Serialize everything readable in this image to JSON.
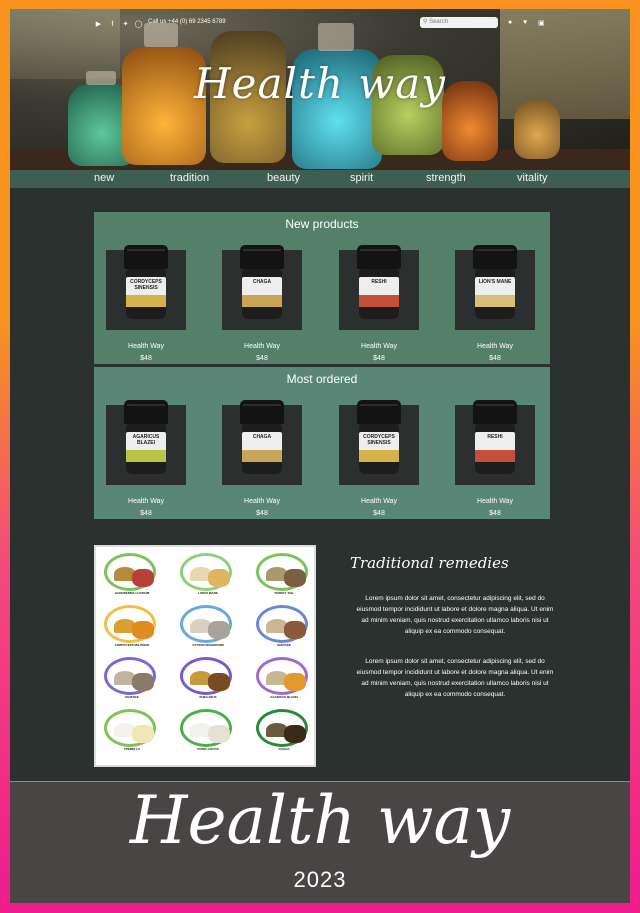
{
  "header": {
    "phone": "Call us +44 (0) 69 2345 6789",
    "search_placeholder": "Search",
    "logo_text": "Health way",
    "social_icons": [
      "youtube-icon",
      "facebook-icon",
      "twitter-icon",
      "instagram-icon"
    ],
    "user_icons": [
      "user-icon",
      "heart-icon",
      "cart-icon"
    ]
  },
  "nav": [
    "new",
    "tradition",
    "beauty",
    "spirit",
    "strength",
    "vitality"
  ],
  "new_products": {
    "title": "New products",
    "items": [
      {
        "jar_label": "CORDYCEPS SINENSIS",
        "band_color": "#d6b24a",
        "brand": "Health Way",
        "price": "$48"
      },
      {
        "jar_label": "CHAGA",
        "band_color": "#c9a557",
        "brand": "Health Way",
        "price": "$48"
      },
      {
        "jar_label": "RESHI",
        "band_color": "#c5503a",
        "brand": "Health Way",
        "price": "$48"
      },
      {
        "jar_label": "LION'S MANE",
        "band_color": "#d9c07a",
        "brand": "Health Way",
        "price": "$48"
      }
    ]
  },
  "most_ordered": {
    "title": "Most ordered",
    "items": [
      {
        "jar_label": "AGARICUS BLAZEI",
        "band_color": "#b9c547",
        "brand": "Health Way",
        "price": "$48"
      },
      {
        "jar_label": "CHAGA",
        "band_color": "#c9a557",
        "brand": "Health Way",
        "price": "$48"
      },
      {
        "jar_label": "CORDYCEPS SINENSIS",
        "band_color": "#d6b24a",
        "brand": "Health Way",
        "price": "$48"
      },
      {
        "jar_label": "RESHI",
        "band_color": "#c5503a",
        "brand": "Health Way",
        "price": "$48"
      }
    ]
  },
  "remedies": {
    "title": "Traditional remedies",
    "paragraphs": [
      "Lorem ipsum dolor sit amet, consectetur adipiscing elit, sed do eiusmod tempor incididunt ut labore et dolore magna aliqua. Ut enim ad minim veniam, quis nostrud exercitation ullamco laboris nisi ut aliquip ex ea commodo consequat.",
      "Lorem ipsum dolor sit amet, consectetur adipiscing elit, sed do eiusmod tempor incididunt ut labore et dolore magna aliqua. Ut enim ad minim veniam, quis nostrud exercitation ullamco laboris nisi ut aliquip ex ea commodo consequat."
    ],
    "grid": [
      {
        "name": "GANODERMA LUCIDUM",
        "ring": "#7cc35a",
        "pile": "#b58b3a",
        "dry": "#b8403a"
      },
      {
        "name": "LION'S MANE",
        "ring": "#8fd07a",
        "pile": "#e8d7b0",
        "dry": "#e0b560"
      },
      {
        "name": "TURKEY TAIL",
        "ring": "#7cc35a",
        "pile": "#a89a6a",
        "dry": "#7a6040"
      },
      {
        "name": "CORDYCEPS MILITARIS",
        "ring": "#f0c040",
        "pile": "#d9a030",
        "dry": "#e08a20"
      },
      {
        "name": "OYSTER MUSHROOM",
        "ring": "#6aa8e0",
        "pile": "#d8d2c6",
        "dry": "#a8a39a"
      },
      {
        "name": "SHIITAKE",
        "ring": "#6a8ad8",
        "pile": "#c8b894",
        "dry": "#8a5a3a"
      },
      {
        "name": "MAITAKE",
        "ring": "#7a6ad0",
        "pile": "#c0b4a0",
        "dry": "#8a7a6a"
      },
      {
        "name": "PHELLINUS",
        "ring": "#7a5ad0",
        "pile": "#c99a3a",
        "dry": "#7a4a20"
      },
      {
        "name": "AGARICUS BLAZEI",
        "ring": "#a06ad0",
        "pile": "#c8b890",
        "dry": "#e09a30"
      },
      {
        "name": "TREMELLA",
        "ring": "#7cc35a",
        "pile": "#f4f2ea",
        "dry": "#f0e6b8"
      },
      {
        "name": "PORIA COCOS",
        "ring": "#4ab04a",
        "pile": "#f1f1ee",
        "dry": "#e6e1d2"
      },
      {
        "name": "CHAGA",
        "ring": "#2a8a3a",
        "pile": "#6a5a40",
        "dry": "#3a2a1a"
      }
    ]
  },
  "footer": {
    "title": "Health way",
    "year": "2023"
  }
}
